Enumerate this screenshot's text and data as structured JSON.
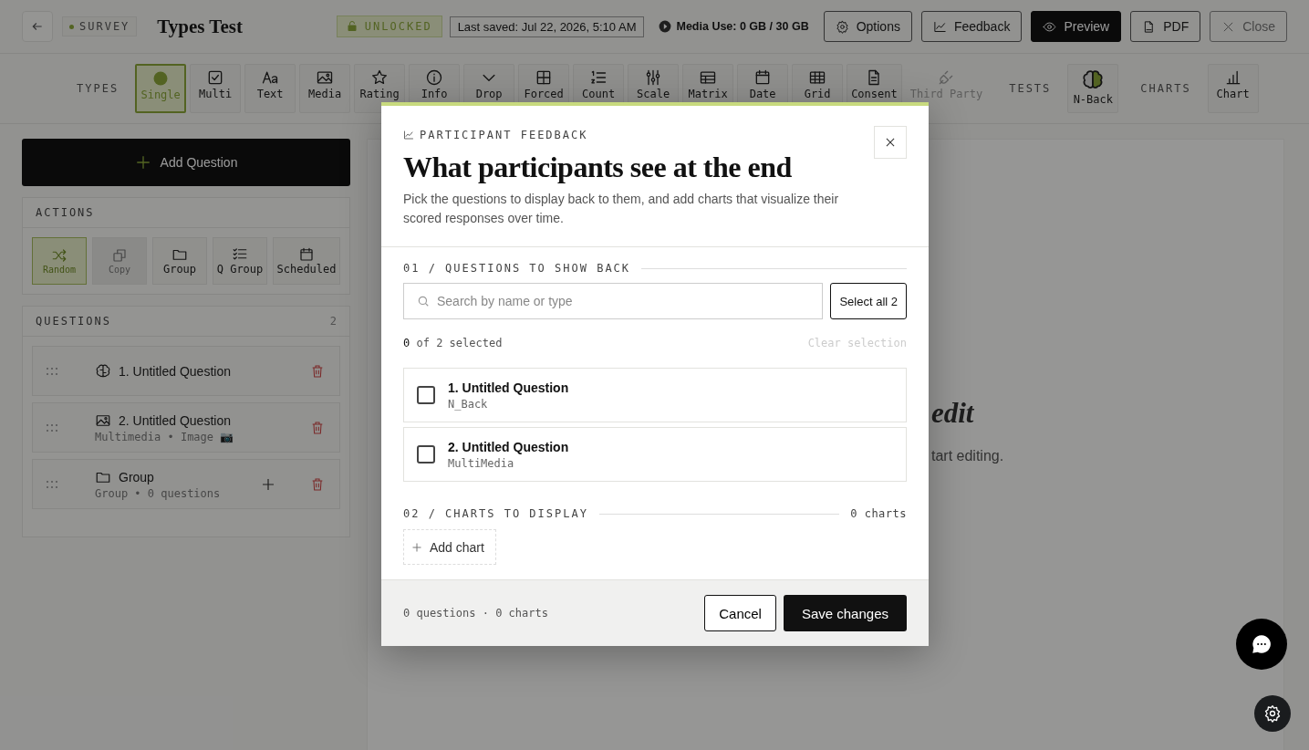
{
  "header": {
    "badge": "SURVEY",
    "title": "Types Test",
    "lock_status": "UNLOCKED",
    "last_saved": "Last saved: Jul 22, 2026, 5:10 AM",
    "media_use": "Media Use: 0 GB / 30 GB",
    "buttons": [
      {
        "label": "Options",
        "kind": "options"
      },
      {
        "label": "Feedback",
        "kind": "feedback"
      },
      {
        "label": "Preview",
        "kind": "preview"
      },
      {
        "label": "PDF",
        "kind": "pdf"
      },
      {
        "label": "Close",
        "kind": "close"
      }
    ]
  },
  "toolbar": {
    "sections": [
      {
        "label": "TYPES",
        "items": [
          {
            "label": "Single",
            "kind": "single",
            "selected": true,
            "disabled": false
          },
          {
            "label": "Multi",
            "kind": "multi",
            "selected": false,
            "disabled": false
          },
          {
            "label": "Text",
            "kind": "text",
            "selected": false,
            "disabled": false
          },
          {
            "label": "Media",
            "kind": "media",
            "selected": false,
            "disabled": false
          },
          {
            "label": "Rating",
            "kind": "rating",
            "selected": false,
            "disabled": false
          },
          {
            "label": "Info",
            "kind": "info",
            "selected": false,
            "disabled": false
          },
          {
            "label": "Drop",
            "kind": "drop",
            "selected": false,
            "disabled": false
          },
          {
            "label": "Forced",
            "kind": "forced",
            "selected": false,
            "disabled": false
          },
          {
            "label": "Count",
            "kind": "count",
            "selected": false,
            "disabled": false
          },
          {
            "label": "Scale",
            "kind": "scale",
            "selected": false,
            "disabled": false
          },
          {
            "label": "Matrix",
            "kind": "matrix",
            "selected": false,
            "disabled": false
          },
          {
            "label": "Date",
            "kind": "date",
            "selected": false,
            "disabled": false
          },
          {
            "label": "Grid",
            "kind": "grid",
            "selected": false,
            "disabled": false
          },
          {
            "label": "Consent",
            "kind": "consent",
            "selected": false,
            "disabled": false
          },
          {
            "label": "Third Party",
            "kind": "plug",
            "selected": false,
            "disabled": true
          }
        ]
      },
      {
        "label": "TESTS",
        "items": [
          {
            "label": "N-Back",
            "kind": "brain",
            "selected": false,
            "disabled": false
          }
        ]
      },
      {
        "label": "CHARTS",
        "items": [
          {
            "label": "Chart",
            "kind": "chart",
            "selected": false,
            "disabled": false
          }
        ]
      }
    ]
  },
  "sidebar": {
    "add_question": "Add Question",
    "actions": {
      "title": "ACTIONS",
      "items": [
        {
          "label": "Random",
          "kind": "shuffle",
          "selected": true,
          "disabled": false
        },
        {
          "label": "Copy",
          "kind": "copy",
          "selected": false,
          "disabled": true
        },
        {
          "label": "Group",
          "kind": "folder",
          "selected": false,
          "disabled": false
        },
        {
          "label": "Q Group",
          "kind": "listcheck",
          "selected": false,
          "disabled": false
        },
        {
          "label": "Scheduled",
          "kind": "calendar",
          "selected": false,
          "disabled": false
        }
      ]
    },
    "questions": {
      "title": "QUESTIONS",
      "count": "2",
      "items": [
        {
          "kind": "brain",
          "title": "1. Untitled Question"
        },
        {
          "kind": "image",
          "title": "2. Untitled Question",
          "subtitle": "Multimedia • Image 📷"
        },
        {
          "kind": "group",
          "title": "Group",
          "subtitle": "Group • 0 questions"
        }
      ]
    }
  },
  "main": {
    "heading": "edit",
    "text": "tart editing."
  },
  "modal": {
    "eyebrow": "PARTICIPANT FEEDBACK",
    "title": "What participants see at the end",
    "description": "Pick the questions to display back to them, and add charts that visualize their scored responses over time.",
    "section_1": {
      "label": "01 / QUESTIONS TO SHOW BACK",
      "search": {
        "placeholder": "Search by name or type"
      },
      "select_all": "Select all 2",
      "selection_count": "**0** of 2 selected",
      "clear": {
        "label": "Clear selection",
        "disabled": true
      },
      "questions": [
        {
          "title": "1. Untitled Question",
          "type": "N_Back",
          "checked": false
        },
        {
          "title": "2. Untitled Question",
          "type": "MultiMedia",
          "checked": false
        }
      ]
    },
    "section_2": {
      "label": "02 / CHARTS TO DISPLAY",
      "count": "0 charts",
      "add_chart": "Add chart"
    },
    "footer": {
      "summary": "0 questions · 0 charts",
      "cancel": "Cancel",
      "save": "Save changes"
    }
  }
}
